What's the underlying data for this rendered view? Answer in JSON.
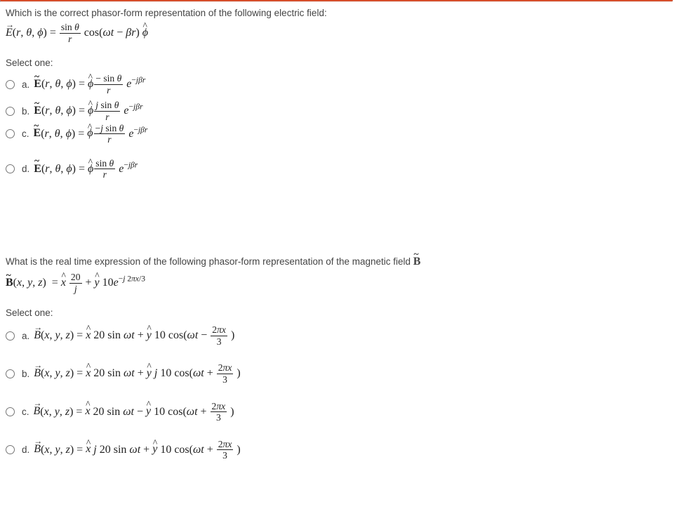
{
  "q1": {
    "prompt": "Which is the correct phasor-form representation of the following electric field:",
    "formula_html": "<span class='arrow-over'><i>E</i></span>(<i>r</i>, <i>θ</i>, <i>ϕ</i>) = <span class='frac'><span class='num'>sin <i>θ</i></span><span class='den'><i>r</i></span></span> cos(<i>ωt</i> − <i>βr</i>) <span class='hat-over'><i>ϕ</i></span>",
    "select_label": "Select one:",
    "options": [
      {
        "key": "a.",
        "html": "<span class='tilde-over bold'>E</span>(<i>r</i>, <i>θ</i>, <i>ϕ</i>) = <span class='hat-over'><i>ϕ</i></span><span class='frac'><span class='num'>− sin <i>θ</i></span><span class='den'><i>r</i></span></span> <i>e</i><sup>−<i>jβr</i></sup>"
      },
      {
        "key": "b.",
        "html": "<span class='tilde-over bold'>E</span>(<i>r</i>, <i>θ</i>, <i>ϕ</i>) = <span class='hat-over'><i>ϕ</i></span><span class='frac'><span class='num'><i>j</i> sin <i>θ</i></span><span class='den'><i>r</i></span></span> <i>e</i><sup>−<i>jβr</i></sup>"
      },
      {
        "key": "c.",
        "html": "<span class='tilde-over bold'>E</span>(<i>r</i>, <i>θ</i>, <i>ϕ</i>) = <span class='hat-over'><i>ϕ</i></span><span class='frac'><span class='num'>−<i>j</i> sin <i>θ</i></span><span class='den'><i>r</i></span></span> <i>e</i><sup>−<i>jβr</i></sup>"
      },
      {
        "key": "d.",
        "html": "<span class='tilde-over bold'>E</span>(<i>r</i>, <i>θ</i>, <i>ϕ</i>) = <span class='hat-over'><i>ϕ</i></span><span class='frac'><span class='num'>sin <i>θ</i></span><span class='den'><i>r</i></span></span> <i>e</i><sup>−<i>jβr</i></sup>"
      }
    ]
  },
  "q2": {
    "prompt_html": "What is the real time expression of the following phasor-form representation of the magnetic field <span class='tilde-over bold' style='font-family:\"Times New Roman\",serif;font-size:16px;'>B</span>",
    "formula_html": "<span class='tilde-over bold'>B</span>(<i>x</i>, <i>y</i>, <i>z</i>)&nbsp; = <span class='hat-over'><i>x</i></span> <span class='frac'><span class='num'>20</span><span class='den'><i>j</i></span></span> + <span class='hat-over'><i>y</i></span> 10<i>e</i><sup>−<i>j</i> 2<i>πx</i>/3</sup>",
    "select_label": "Select one:",
    "options": [
      {
        "key": "a.",
        "html": "<span class='arrow-over'><i>B</i></span>(<i>x</i>, <i>y</i>, <i>z</i>) = <span class='hat-over'><i>x</i></span> 20 sin <i>ωt</i> + <span class='hat-over'><i>y</i></span> 10 cos(<i>ωt</i> − <span class='frac'><span class='num'>2<i>πx</i></span><span class='den'>3</span></span> )"
      },
      {
        "key": "b.",
        "html": "<span class='arrow-over'><i>B</i></span>(<i>x</i>, <i>y</i>, <i>z</i>) = <span class='hat-over'><i>x</i></span> 20 sin <i>ωt</i> + <span class='hat-over'><i>y</i></span> <i>j</i> 10 cos(<i>ωt</i> + <span class='frac'><span class='num'>2<i>πx</i></span><span class='den'>3</span></span> )"
      },
      {
        "key": "c.",
        "html": "<span class='arrow-over'><i>B</i></span>(<i>x</i>, <i>y</i>, <i>z</i>) = <span class='hat-over'><i>x</i></span> 20 sin <i>ωt</i> − <span class='hat-over'><i>y</i></span> 10 cos(<i>ωt</i> + <span class='frac'><span class='num'>2<i>πx</i></span><span class='den'>3</span></span> )"
      },
      {
        "key": "d.",
        "html": "<span class='arrow-over'><i>B</i></span>(<i>x</i>, <i>y</i>, <i>z</i>) = <span class='hat-over'><i>x</i></span> <i>j</i> 20 sin <i>ωt</i> + <span class='hat-over'><i>y</i></span> 10 cos(<i>ωt</i> + <span class='frac'><span class='num'>2<i>πx</i></span><span class='den'>3</span></span> )"
      }
    ]
  }
}
